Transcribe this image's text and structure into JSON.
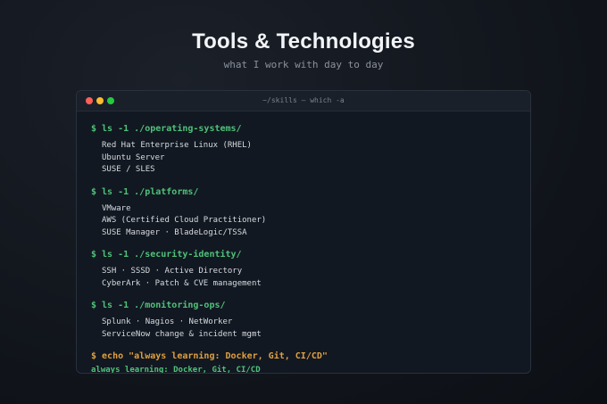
{
  "header": {
    "title": "Tools & Technologies",
    "subtitle": "what I work with day to day"
  },
  "window": {
    "title": "~/skills — which -a"
  },
  "groups": [
    {
      "command": "$ ls -1 ./operating-systems/",
      "items": [
        "Red Hat Enterprise Linux (RHEL)",
        "Ubuntu Server",
        "SUSE / SLES"
      ]
    },
    {
      "command": "$ ls -1 ./platforms/",
      "items": [
        "VMware",
        "AWS (Certified Cloud Practitioner)",
        "SUSE Manager · BladeLogic/TSSA"
      ]
    },
    {
      "command": "$ ls -1 ./security-identity/",
      "items": [
        "SSH · SSSD · Active Directory",
        "CyberArk · Patch & CVE management"
      ]
    },
    {
      "command": "$ ls -1 ./monitoring-ops/",
      "items": [
        "Splunk · Nagios · NetWorker",
        "ServiceNow change & incident mgmt"
      ]
    }
  ],
  "echo": {
    "command": "$ echo \"always learning: Docker, Git, CI/CD\"",
    "output": "always learning: Docker, Git, CI/CD"
  },
  "colors": {
    "prompt_green": "#4fc27a",
    "echo_orange": "#e0a040",
    "close": "#ff5f57",
    "minimize": "#febc2e",
    "maximize": "#28c840"
  }
}
